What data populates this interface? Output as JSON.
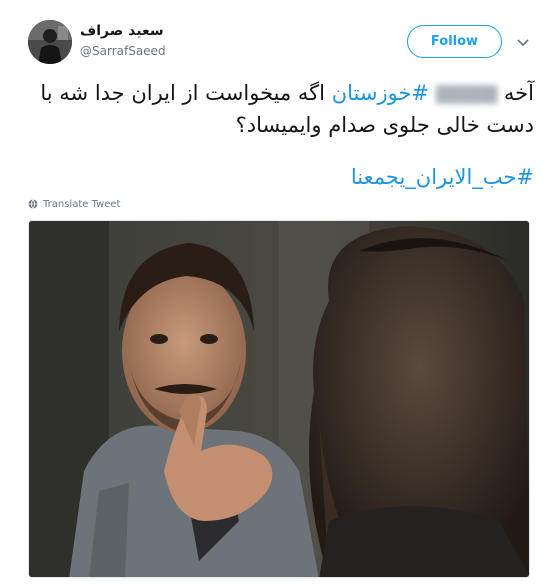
{
  "user": {
    "display_name": "سعید صراف",
    "handle": "@SarrafSaeed"
  },
  "follow_button": {
    "label": "Follow"
  },
  "tweet": {
    "text_start": "آخه",
    "text_blurred": "▓▓▓▓▓",
    "hashtag_1": "#خوزستان",
    "text_rest": "اگه میخواست از ایران جدا شه با دست خالی جلوی صدام وایمیساد؟",
    "hashtag_2": "#حب_الایران_یجمعنا"
  },
  "translate": {
    "label": "Translate Tweet"
  },
  "colors": {
    "link": "#1b95e0",
    "follow": "#1da1f2",
    "secondary_text": "#657786"
  },
  "icons": {
    "caret": "chevron-down-icon",
    "translate": "globe-icon"
  }
}
